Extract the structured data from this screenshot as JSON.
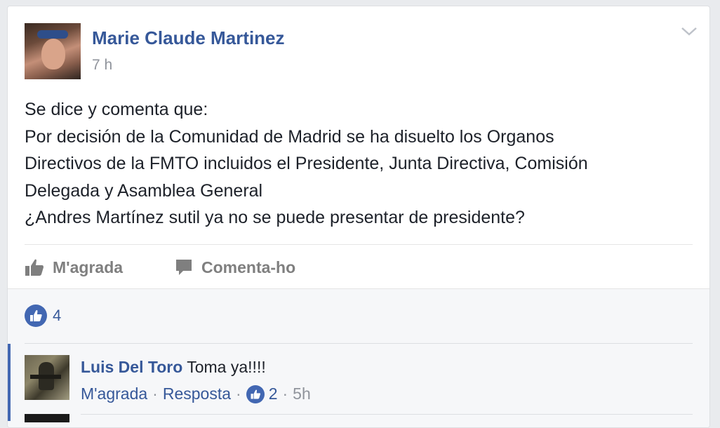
{
  "post": {
    "author": "Marie Claude Martinez",
    "time": "7 h",
    "text_lines": [
      "Se dice y comenta que:",
      "Por decisión de la Comunidad de Madrid se ha disuelto los Organos",
      "Directivos de la FMTO incluidos el Presidente, Junta Directiva, Comisión",
      "Delegada y Asamblea General",
      "¿Andres Martínez sutil ya no se puede presentar de presidente?"
    ]
  },
  "actions": {
    "like_label": "M'agrada",
    "comment_label": "Comenta-ho"
  },
  "reactions": {
    "count": "4"
  },
  "comment": {
    "author": "Luis Del Toro",
    "text": "Toma ya!!!!",
    "like_link": "M'agrada",
    "reply_link": "Resposta",
    "separator": "·",
    "like_count": "2",
    "time": "5h"
  },
  "colors": {
    "link_blue": "#365899",
    "like_badge_blue": "#4267b2",
    "muted_gray": "#90949c",
    "action_gray": "#7f7f7f"
  },
  "icons": [
    "chevron-down-icon",
    "thumbs-up-icon",
    "comment-bubble-icon",
    "like-badge-icon"
  ]
}
